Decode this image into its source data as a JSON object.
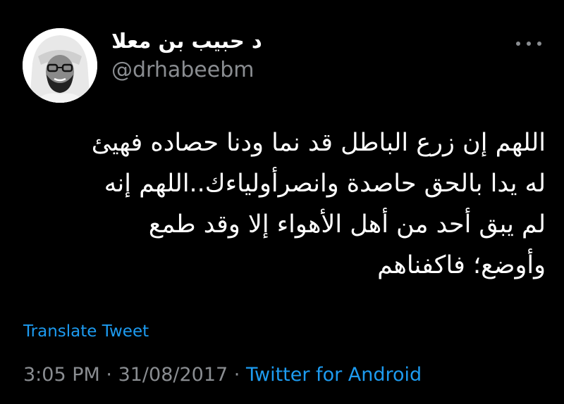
{
  "author": {
    "display_name": "د حبيب بن معلا",
    "handle": "@drhabeebm",
    "avatar": "profile-photo-avatar"
  },
  "more_icon": "ellipsis-icon",
  "tweet": {
    "lines": [
      "اللهم إن زرع الباطل قد نما ودنا حصاده فهيئ",
      "له يدا بالحق حاصدة وانصرأولياءك..اللهم إنه",
      "لم يبق أحد من أهل الأهواء إلا وقد طمع",
      "وأوضع؛ فاكفناهم"
    ]
  },
  "translate_label": "Translate Tweet",
  "meta": {
    "time": "3:05 PM",
    "separator": "·",
    "date": "31/08/2017",
    "source": "Twitter for Android"
  },
  "colors": {
    "background": "#000000",
    "text": "#ffffff",
    "secondary": "#8a8d91",
    "link": "#1d9bf0"
  }
}
